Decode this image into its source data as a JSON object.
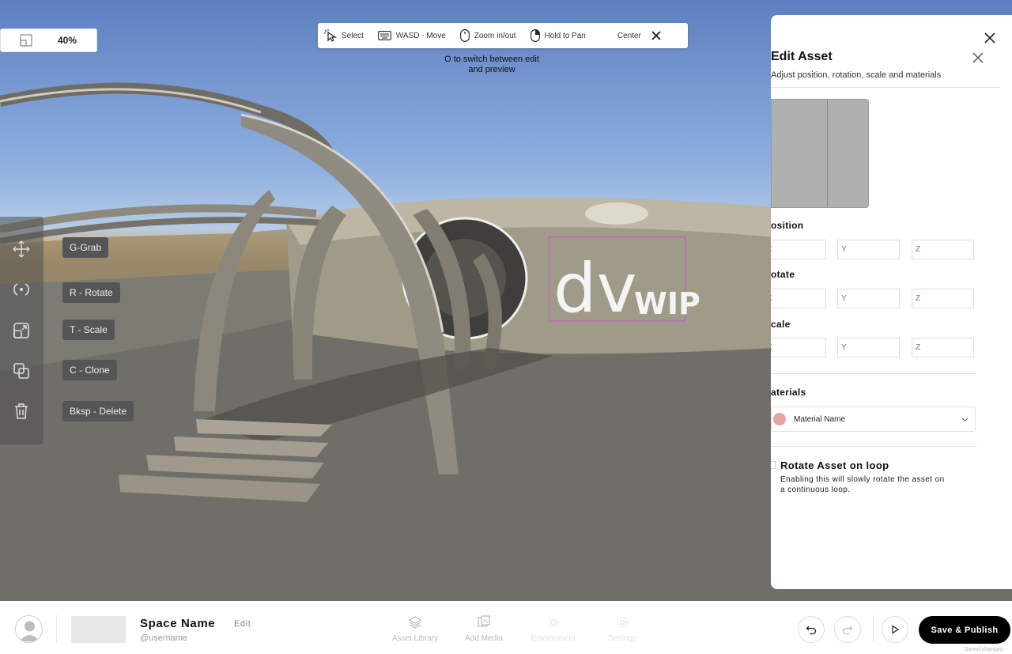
{
  "zoom": {
    "icon": "fit-view-icon",
    "value": "40%"
  },
  "toolbar": {
    "items": [
      {
        "icon": "cursor-select-icon",
        "label": "Select"
      },
      {
        "icon": "keyboard-icon",
        "label": "WASD - Move"
      },
      {
        "icon": "mouse-scroll-icon",
        "label": "Zoom in/out"
      },
      {
        "icon": "mouse-right-icon",
        "label": "Hold to Pan"
      }
    ],
    "center_label": "Center",
    "close_icon": "close-icon"
  },
  "hint": "O to switch between edit and preview",
  "transform_tools": [
    {
      "icon": "move-arrows-icon",
      "shortcut": "G-Grab"
    },
    {
      "icon": "rotate-icon",
      "shortcut": "R - Rotate"
    },
    {
      "icon": "scale-icon",
      "shortcut": "T - Scale"
    },
    {
      "icon": "clone-icon",
      "shortcut": "C - Clone"
    },
    {
      "icon": "trash-icon",
      "shortcut": "Bksp - Delete"
    }
  ],
  "scene": {
    "sign_text_1": "dv",
    "sign_text_2": "WIP"
  },
  "edit_panel": {
    "title": "Edit Asset",
    "subtitle": "Adjust position, rotation, scale and materials",
    "position_label": "osition",
    "rotate_label": "otate",
    "scale_label": "cale",
    "axis_placeholders": [
      "X",
      "Y",
      "Z"
    ],
    "materials_label": "aterials",
    "material_name": "Material Name",
    "material_color": "#e8a4a4",
    "rotate_loop_title": "Rotate Asset on loop",
    "rotate_loop_desc": "Enabling this will slowly rotate the asset on a continuous loop."
  },
  "bottom_bar": {
    "space_name": "Space Name",
    "edit_label": "Edit",
    "username": "@username",
    "nav": [
      {
        "icon": "layers-icon",
        "label": "Asset Library"
      },
      {
        "icon": "media-icon",
        "label": "Add Media"
      },
      {
        "icon": "environment-icon",
        "label": "Environment"
      },
      {
        "icon": "settings-icon",
        "label": "Settings"
      }
    ],
    "publish_label": "Save & Publish",
    "saved_note": "Saved changes"
  }
}
